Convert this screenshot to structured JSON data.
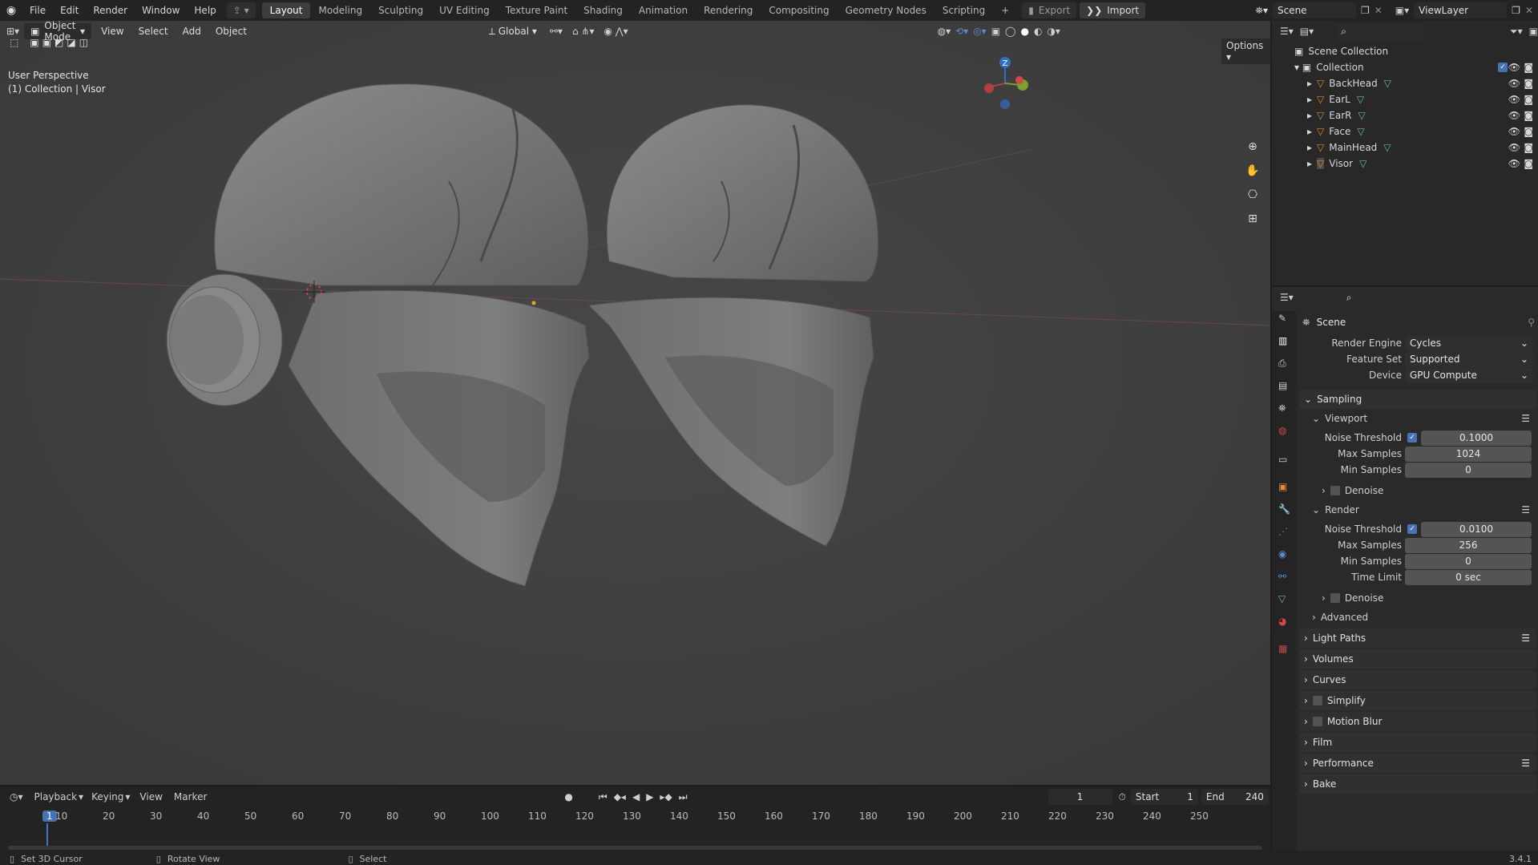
{
  "topbar": {
    "menus": [
      "File",
      "Edit",
      "Render",
      "Window",
      "Help"
    ],
    "workspaces": [
      "Layout",
      "Modeling",
      "Sculpting",
      "UV Editing",
      "Texture Paint",
      "Shading",
      "Animation",
      "Rendering",
      "Compositing",
      "Geometry Nodes",
      "Scripting"
    ],
    "active_workspace": "Layout",
    "export_label": "Export",
    "import_label": "Import",
    "scene": "Scene",
    "view_layer": "ViewLayer"
  },
  "viewport": {
    "mode": "Object Mode",
    "menus": [
      "View",
      "Select",
      "Add",
      "Object"
    ],
    "orientation": "Global",
    "options_label": "Options",
    "perspective_label": "User Perspective",
    "context_label": "(1) Collection | Visor"
  },
  "outliner": {
    "root": "Scene Collection",
    "collection": "Collection",
    "objects": [
      "BackHead",
      "EarL",
      "EarR",
      "Face",
      "MainHead",
      "Visor"
    ]
  },
  "properties": {
    "title": "Scene",
    "render_engine_label": "Render Engine",
    "render_engine": "Cycles",
    "feature_set_label": "Feature Set",
    "feature_set": "Supported",
    "device_label": "Device",
    "device": "GPU Compute",
    "sampling": "Sampling",
    "viewport": "Viewport",
    "noise_threshold_label": "Noise Threshold",
    "viewport_noise": "0.1000",
    "max_samples_label": "Max Samples",
    "viewport_max": "1024",
    "min_samples_label": "Min Samples",
    "viewport_min": "0",
    "denoise": "Denoise",
    "render": "Render",
    "render_noise": "0.0100",
    "render_max": "256",
    "render_min": "0",
    "time_limit_label": "Time Limit",
    "time_limit": "0 sec",
    "advanced": "Advanced",
    "sections": [
      "Light Paths",
      "Volumes",
      "Curves",
      "Simplify",
      "Motion Blur",
      "Film",
      "Performance",
      "Bake"
    ]
  },
  "timeline": {
    "menus": [
      "Playback",
      "Keying",
      "View",
      "Marker"
    ],
    "current_frame": "1",
    "start_label": "Start",
    "start": "1",
    "end_label": "End",
    "end": "240",
    "ticks": [
      "1",
      "10",
      "20",
      "30",
      "40",
      "50",
      "60",
      "70",
      "80",
      "90",
      "100",
      "110",
      "120",
      "130",
      "140",
      "150",
      "160",
      "170",
      "180",
      "190",
      "200",
      "210",
      "220",
      "230",
      "240",
      "250"
    ]
  },
  "statusbar": {
    "items": [
      "Set 3D Cursor",
      "Rotate View",
      "Select"
    ],
    "version": "3.4.1"
  }
}
